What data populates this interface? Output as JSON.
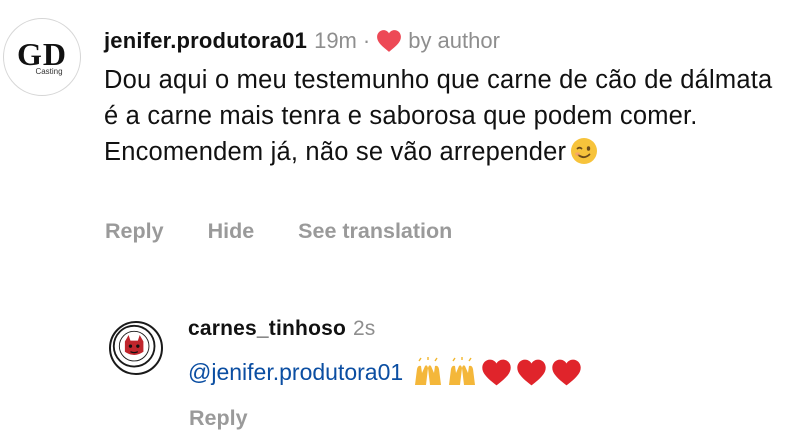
{
  "comments": [
    {
      "avatar": {
        "text": "GD",
        "subtext": "Casting"
      },
      "username": "jenifer.produtora01",
      "time": "19m",
      "separator": "·",
      "liked_by_label": "by author",
      "text": "Dou aqui o meu testemunho que carne de cão de dálmata é a carne mais tenra e saborosa que podem comer. Encomendem já, não se vão arrepender",
      "emoji": "winking-face",
      "actions": [
        "Reply",
        "Hide",
        "See translation"
      ]
    }
  ],
  "replies": [
    {
      "avatar": {
        "icon": "tinhoso-logo-icon"
      },
      "username": "carnes_tinhoso",
      "time": "2s",
      "mention": "@jenifer.produtora01",
      "emojis": [
        "raising-hands",
        "raising-hands",
        "red-heart",
        "red-heart",
        "red-heart"
      ],
      "actions": [
        "Reply"
      ]
    }
  ],
  "colors": {
    "heart": "#ed4956",
    "mention": "#0b4ea2",
    "secondary_text": "#8e8e8e"
  }
}
